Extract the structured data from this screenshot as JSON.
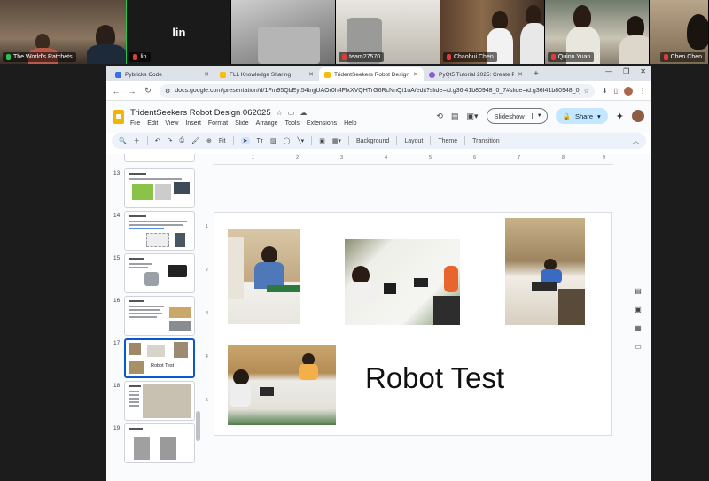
{
  "gallery": {
    "participants": [
      {
        "name": "The World's Ratchets",
        "muted": false,
        "active": true
      },
      {
        "name": "lin",
        "muted": true,
        "active": false,
        "display_name": "lin"
      },
      {
        "name": "",
        "muted": false,
        "active": false
      },
      {
        "name": "team27570",
        "muted": true,
        "active": false
      },
      {
        "name": "Chaohui Chen",
        "muted": true,
        "active": false
      },
      {
        "name": "",
        "muted": false,
        "active": false
      },
      {
        "name": "Quinn Yuan",
        "muted": true,
        "active": false
      },
      {
        "name": "Chen Chen",
        "muted": true,
        "active": false
      }
    ]
  },
  "browser": {
    "tabs": [
      {
        "label": "Pybricks Code",
        "active": false
      },
      {
        "label": "FLL Knowledge Sharing",
        "active": false
      },
      {
        "label": "TridentSeekers Robot Design 0",
        "active": true
      },
      {
        "label": "PyQt5 Tutorial 2025: Create PyQ",
        "active": false
      }
    ],
    "new_tab": "+",
    "url": "docs.google.com/presentation/d/1Fm95QbEyt54tnjjUAOr0h4FlxXVQHTrG6RcNnQt1uA/edit?slide=id.g36f41b80948_0_7#slide=id.g36f41b80948_0_7"
  },
  "slides": {
    "title": "TridentSeekers Robot Design 062025",
    "menus": [
      "File",
      "Edit",
      "View",
      "Insert",
      "Format",
      "Slide",
      "Arrange",
      "Tools",
      "Extensions",
      "Help"
    ],
    "slideshow_label": "Slideshow",
    "share_label": "Share",
    "toolbar": {
      "zoom": "Fit",
      "background": "Background",
      "layout": "Layout",
      "theme": "Theme",
      "transition": "Transition"
    },
    "filmstrip": [
      {
        "num": "13"
      },
      {
        "num": "14"
      },
      {
        "num": "15"
      },
      {
        "num": "16"
      },
      {
        "num": "17",
        "selected": true,
        "caption": "Robot Test"
      },
      {
        "num": "18"
      },
      {
        "num": "19"
      }
    ],
    "ruler_h": [
      "1",
      "2",
      "3",
      "4",
      "5",
      "6",
      "7",
      "8",
      "9"
    ],
    "ruler_v": [
      "1",
      "2",
      "3",
      "4",
      "5"
    ],
    "current_slide": {
      "title_text": "Robot Test"
    }
  }
}
